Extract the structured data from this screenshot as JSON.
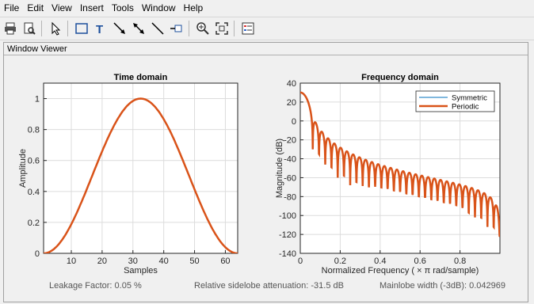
{
  "menu": [
    "File",
    "Edit",
    "View",
    "Insert",
    "Tools",
    "Window",
    "Help"
  ],
  "toolbar": [
    "print-icon",
    "print-preview-icon",
    "pointer-icon",
    "rectangle-icon",
    "text-icon",
    "arrow-icon",
    "double-arrow-icon",
    "line-icon",
    "pin-icon",
    "zoom-in-icon",
    "fit-icon",
    "legend-icon"
  ],
  "panel_title": "Window Viewer",
  "colors": {
    "symmetric": "#0072bd",
    "periodic": "#d95319"
  },
  "status": {
    "leakage": "Leakage Factor: 0.05 %",
    "sidelobe": "Relative sidelobe attenuation: -31.5 dB",
    "mainlobe": "Mainlobe width (-3dB): 0.042969"
  },
  "chart_data": [
    {
      "type": "line",
      "title": "Time domain",
      "xlabel": "Samples",
      "ylabel": "Amplitude",
      "xlim": [
        1,
        64
      ],
      "ylim": [
        0,
        1.1
      ],
      "xticks": [
        10,
        20,
        30,
        40,
        50,
        60
      ],
      "yticks": [
        0,
        0.2,
        0.4,
        0.6,
        0.8,
        1
      ],
      "xtick_labels": [
        "10",
        "20",
        "30",
        "40",
        "50",
        "60"
      ],
      "ytick_labels": [
        "0",
        "0.2",
        "0.4",
        "0.6",
        "0.8",
        "1"
      ],
      "grid": true,
      "series": [
        {
          "name": "Symmetric",
          "x": [
            1,
            4,
            8,
            12,
            16,
            20,
            24,
            28,
            33,
            38,
            42,
            46,
            50,
            54,
            58,
            62,
            64
          ],
          "y": [
            0,
            0.02,
            0.08,
            0.19,
            0.35,
            0.54,
            0.74,
            0.91,
            1.0,
            0.93,
            0.78,
            0.58,
            0.38,
            0.2,
            0.08,
            0.01,
            0
          ]
        },
        {
          "name": "Periodic",
          "x": [
            1,
            4,
            8,
            12,
            16,
            20,
            24,
            28,
            33,
            38,
            42,
            46,
            50,
            54,
            58,
            62,
            64
          ],
          "y": [
            0,
            0.02,
            0.08,
            0.19,
            0.35,
            0.54,
            0.74,
            0.91,
            1.0,
            0.93,
            0.78,
            0.58,
            0.38,
            0.2,
            0.08,
            0.01,
            0
          ]
        }
      ]
    },
    {
      "type": "line",
      "title": "Frequency domain",
      "xlabel": "Normalized  Frequency    ( × π  rad/sample)",
      "ylabel": "Magnitude (dB)",
      "xlim": [
        0,
        1
      ],
      "ylim": [
        -140,
        40
      ],
      "xticks": [
        0,
        0.2,
        0.4,
        0.6,
        0.8
      ],
      "yticks": [
        -140,
        -120,
        -100,
        -80,
        -60,
        -40,
        -20,
        0,
        20,
        40
      ],
      "xtick_labels": [
        "0",
        "0.2",
        "0.4",
        "0.6",
        "0.8"
      ],
      "ytick_labels": [
        "-140",
        "-120",
        "-100",
        "-80",
        "-60",
        "-40",
        "-20",
        "0",
        "20",
        "40"
      ],
      "grid": true,
      "legend": "top-right",
      "mainlobe_peak_db": 30.1,
      "sidelobe_envelope": {
        "x": [
          0.06,
          0.1,
          0.2,
          0.3,
          0.4,
          0.5,
          0.6,
          0.7,
          0.8,
          0.9,
          1.0
        ],
        "y": [
          3,
          -18,
          -32,
          -42,
          -50,
          -56,
          -62,
          -67,
          -72,
          -78,
          -95
        ]
      },
      "null_depth": {
        "x": [
          0.08,
          0.15,
          0.25,
          0.4,
          0.6,
          0.8,
          1.0
        ],
        "y": [
          -30,
          -55,
          -68,
          -70,
          -80,
          -90,
          -122
        ]
      },
      "series": [
        {
          "name": "Symmetric"
        },
        {
          "name": "Periodic"
        }
      ]
    }
  ]
}
